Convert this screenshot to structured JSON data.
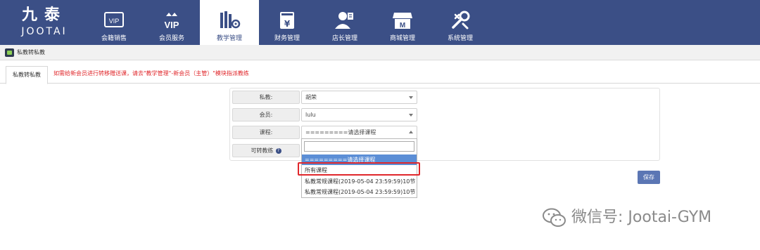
{
  "brand": {
    "name_cn": "九泰",
    "name_en": "JOOTAI"
  },
  "nav": [
    {
      "label": "会籍销售",
      "icon": "vip-card-icon"
    },
    {
      "label": "会员服务",
      "icon": "vip-crown-icon"
    },
    {
      "label": "教学管理",
      "icon": "books-gear-icon",
      "active": true
    },
    {
      "label": "财务管理",
      "icon": "yen-book-icon"
    },
    {
      "label": "店长管理",
      "icon": "manager-icon"
    },
    {
      "label": "商城管理",
      "icon": "store-icon"
    },
    {
      "label": "系统管理",
      "icon": "wrench-icon"
    }
  ],
  "breadcrumb": {
    "icon": "app-icon",
    "text": "私教转私教"
  },
  "tab": {
    "label": "私教转私教"
  },
  "tab_note": "如需给新会员进行转移赠送课，请去\"教学管理\"-新会员（主管）\"模块指派教练",
  "form": {
    "coach_label": "私教:",
    "coach_value": "胡荣",
    "member_label": "会员:",
    "member_value": "lulu",
    "course_label": "课程:",
    "course_value": "=========请选择课程=========",
    "transfer_label": "可转教练"
  },
  "dropdown": {
    "search_value": "",
    "options": [
      "=========请选择课程=========",
      "所有课程",
      "私教常规课程(2019-05-04 23:59:59)10节",
      "私教常规课程(2019-05-04 23:59:59)10节"
    ],
    "selected_index": 0,
    "highlighted_index": 1
  },
  "save_label": "保存",
  "watermark": "微信号: Jootai-GYM",
  "colors": {
    "nav_bg": "#3b4f86",
    "accent": "#5b76b4",
    "note_red": "#e0272b",
    "select_blue": "#5b8ed6"
  }
}
